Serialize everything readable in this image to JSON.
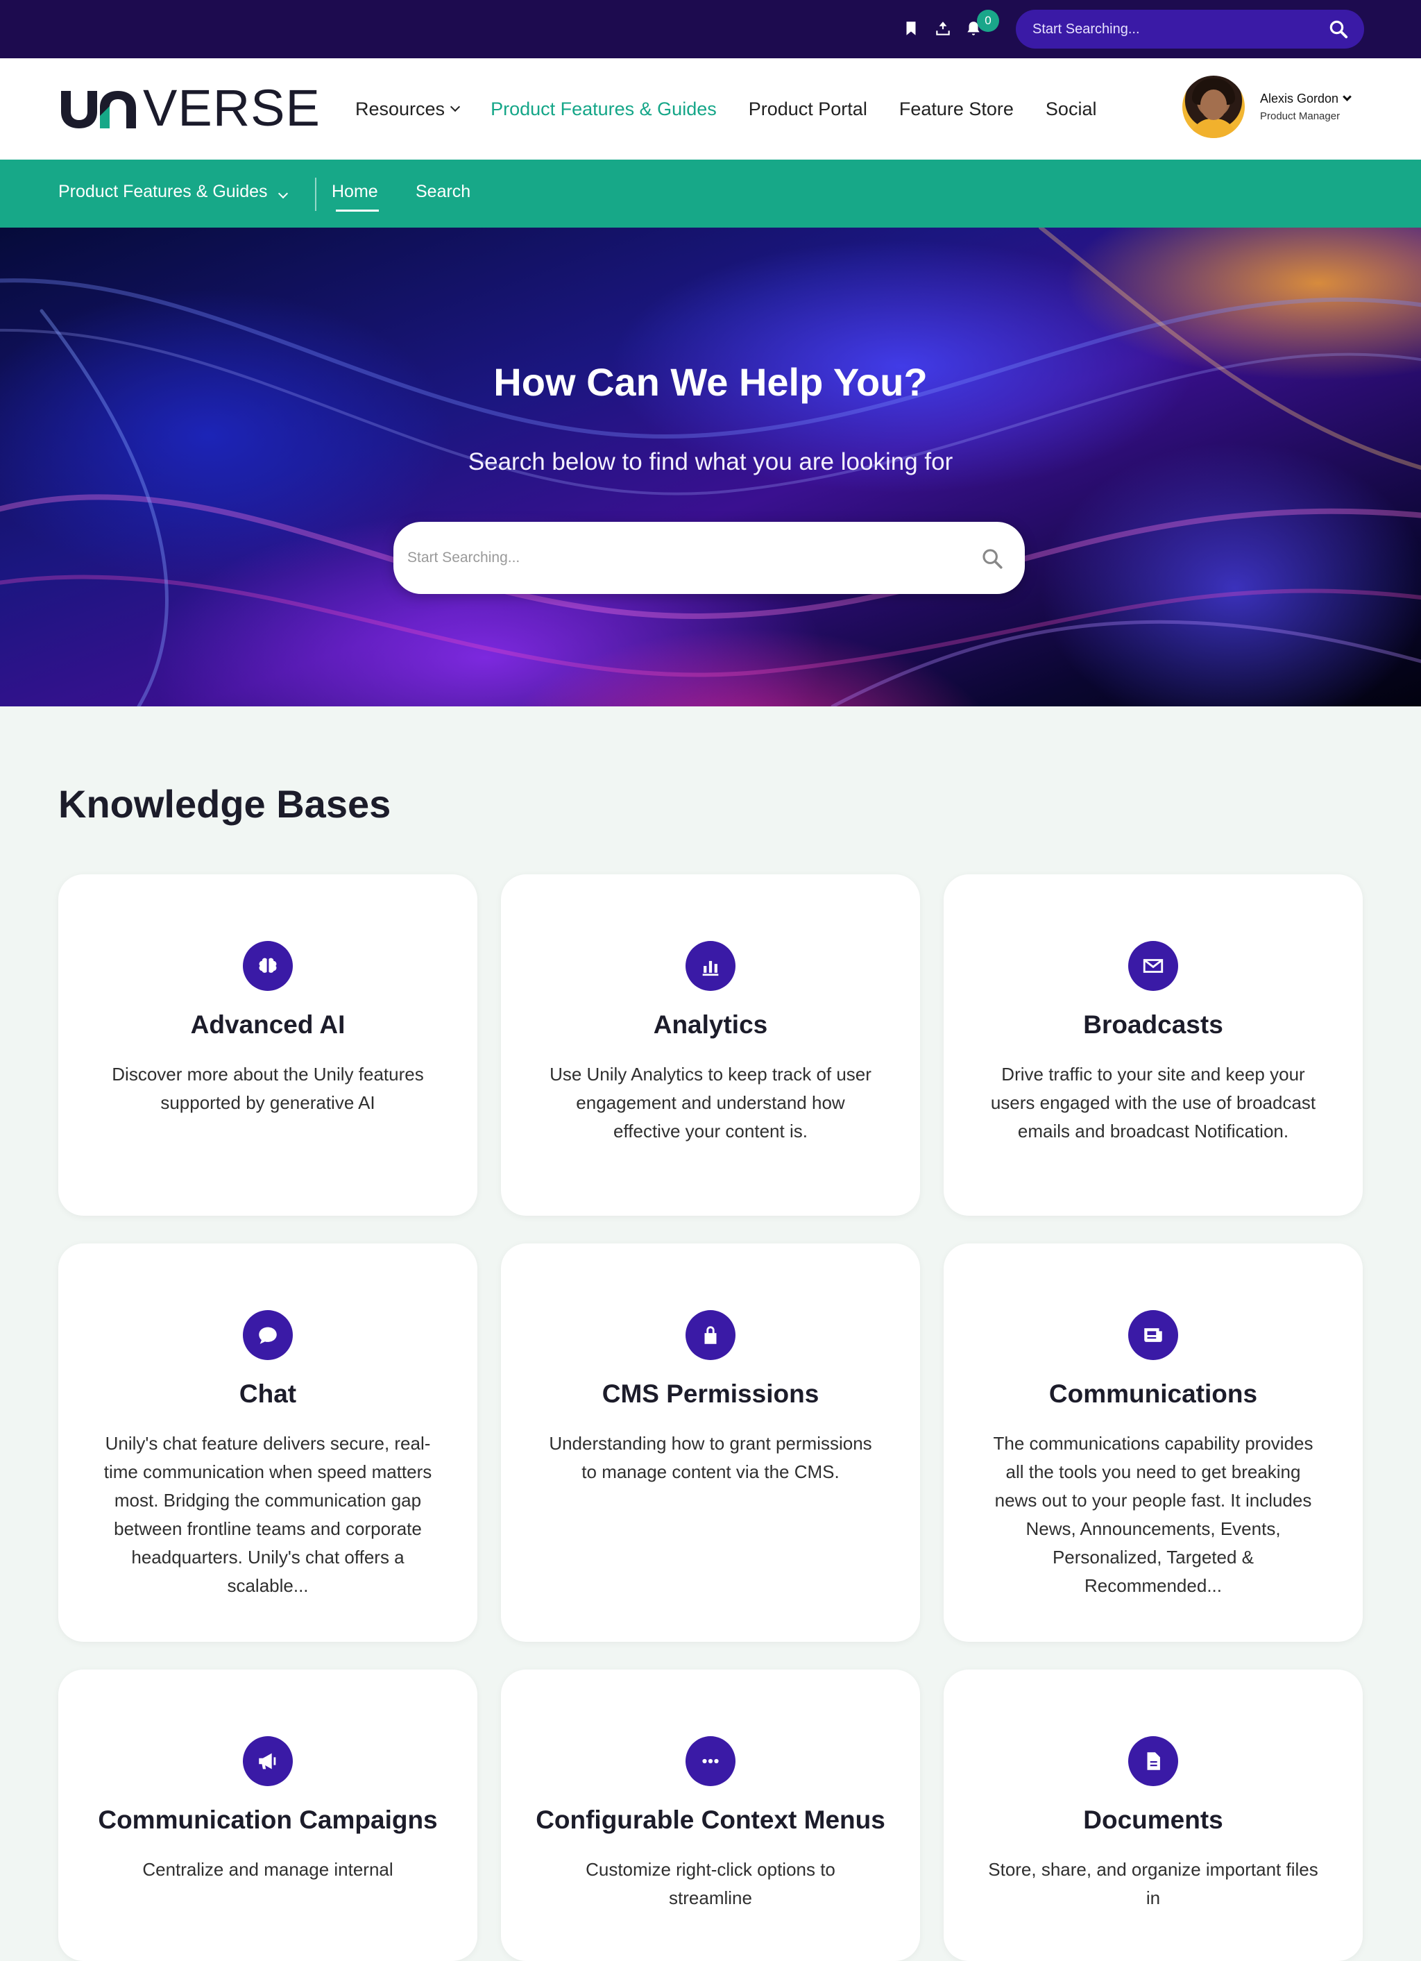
{
  "utility_bar": {
    "icons": [
      "bookmark-icon",
      "upload-icon",
      "bell-icon"
    ],
    "notification_count": "0",
    "search": {
      "placeholder": "Start Searching..."
    }
  },
  "header": {
    "logo_text": "VERSE",
    "logo_brand": "UNIVERSE",
    "nav": [
      {
        "label": "Resources",
        "has_dropdown": true
      },
      {
        "label": "Product Features & Guides",
        "active": true
      },
      {
        "label": "Product Portal"
      },
      {
        "label": "Feature Store"
      },
      {
        "label": "Social"
      }
    ],
    "profile": {
      "name": "Alexis Gordon",
      "role": "Product Manager"
    }
  },
  "subnav": {
    "section": "Product Features & Guides",
    "items": [
      {
        "label": "Home",
        "active": true
      },
      {
        "label": "Search"
      }
    ]
  },
  "hero": {
    "title": "How Can We Help You?",
    "subtitle": "Search below to find what you are looking for",
    "search_placeholder": "Start Searching..."
  },
  "knowledge_bases": {
    "heading": "Knowledge Bases",
    "cards": [
      {
        "title": "Advanced AI",
        "icon": "brain-icon",
        "description": "Discover more about the Unily features supported by generative AI"
      },
      {
        "title": "Analytics",
        "icon": "bar-chart-icon",
        "description": "Use Unily Analytics to keep track of user engagement and understand how effective your content is."
      },
      {
        "title": "Broadcasts",
        "icon": "envelope-icon",
        "description": "Drive traffic to your site and keep your users engaged with the use of broadcast emails and broadcast Notification."
      },
      {
        "title": "Chat",
        "icon": "chat-bubble-icon",
        "description": "Unily's chat feature delivers secure, real-time communication when speed matters most. Bridging the communication gap between frontline teams and corporate headquarters. Unily's chat offers a scalable..."
      },
      {
        "title": "CMS Permissions",
        "icon": "lock-icon",
        "description": "Understanding how to grant permissions to manage content via the CMS."
      },
      {
        "title": "Communications",
        "icon": "news-icon",
        "description": "The communications capability provides all the tools you need to get breaking news out to your people fast. It includes News, Announcements, Events, Personalized, Targeted & Recommended..."
      },
      {
        "title": "Communication Campaigns",
        "icon": "megaphone-icon",
        "description": "Centralize and manage internal"
      },
      {
        "title": "Configurable Context Menus",
        "icon": "more-icon",
        "description": "Customize right-click options to streamline"
      },
      {
        "title": "Documents",
        "icon": "document-icon",
        "description": "Store, share, and organize important files in"
      }
    ]
  },
  "colors": {
    "utility_bar": "#1d0b4f",
    "accent_green": "#17a888",
    "accent_purple": "#3a1aa6",
    "page_background": "#f1f6f3"
  }
}
